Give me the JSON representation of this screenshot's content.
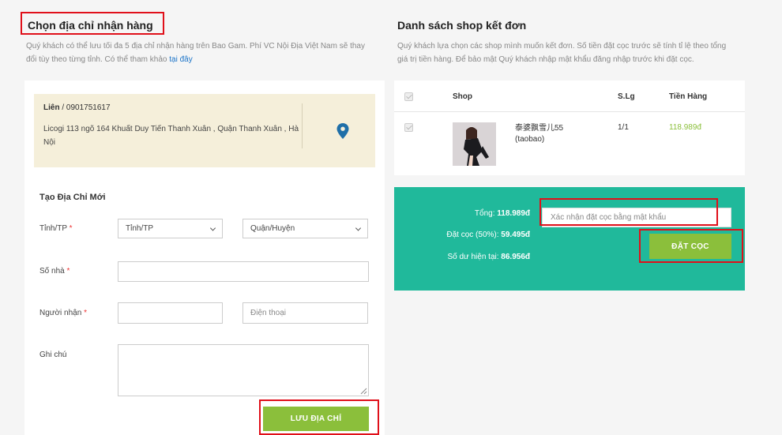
{
  "address_section": {
    "title": "Chọn địa chỉ nhận hàng",
    "description": "Quý khách có thể lưu tối đa 5 địa chỉ nhận hàng trên Bao Gam. Phí VC Nội Địa Việt Nam sẽ thay đổi tùy theo từng tỉnh. Có thể tham khảo",
    "description_link": "tại đây",
    "saved_address": {
      "name": "Liên",
      "separator": " / ",
      "phone": "0901751617",
      "address": "Licogi 113 ngõ 164 Khuất Duy Tiến Thanh Xuân , Quận Thanh Xuân , Hà Nội",
      "icon": "map-pin-icon"
    }
  },
  "new_address_form": {
    "title": "Tạo Địa Chỉ Mới",
    "province_label": "Tỉnh/TP",
    "province_value": "Tỉnh/TP",
    "district_value": "Quận/Huyện",
    "house_label": "Số nhà",
    "house_value": "",
    "receiver_label": "Người nhận",
    "receiver_value": "",
    "phone_placeholder": "Điện thoại",
    "note_label": "Ghi chú",
    "note_value": "",
    "required_mark": "*",
    "save_button": "LƯU ĐỊA CHỈ"
  },
  "shop_section": {
    "title": "Danh sách shop kết đơn",
    "description": "Quý khách lựa chọn các shop mình muốn kết đơn. Số tiền đặt cọc trước sẽ tính tỉ lệ theo tổng giá trị tiền hàng. Để bảo mật Quý khách nhập mật khẩu đăng nhập trước khi đặt cọc.",
    "columns": [
      "Shop",
      "S.Lg",
      "Tiền Hàng"
    ],
    "rows": [
      {
        "shop_name": "泰婆飘雪儿55",
        "platform": "(taobao)",
        "quantity": "1/1",
        "amount": "118.989đ"
      }
    ]
  },
  "summary": {
    "total_label": "Tổng:",
    "total_value": "118.989đ",
    "deposit_label": "Đặt cọc (50%):",
    "deposit_value": "59.495đ",
    "balance_label": "Số dư hiện tại:",
    "balance_value": "86.956đ",
    "password_placeholder": "Xác nhận đặt cọc bằng mật khẩu",
    "deposit_button": "ĐẶT CỌC"
  },
  "colors": {
    "accent_green": "#8bbf3b",
    "summary_teal": "#20b99b",
    "highlight_red": "#e0101a",
    "address_card": "#f5efda"
  }
}
